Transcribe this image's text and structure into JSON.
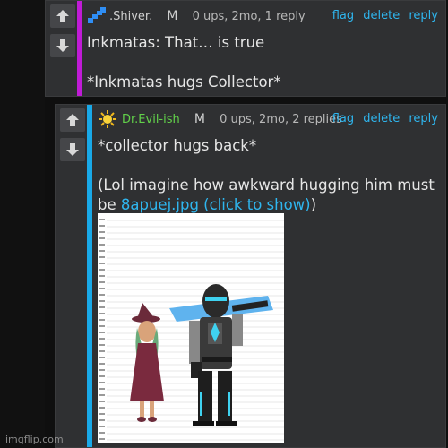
{
  "comments": [
    {
      "username": ".Shiver.",
      "mod_badge": "M",
      "stats": "0 ups, 2mo, 1 reply",
      "actions": [
        "flag",
        "delete",
        "reply"
      ],
      "line1": "Inkmatas: That… is true",
      "line2": "*Inkmatas hugs Collector*",
      "bar_color": "#c01bd6",
      "avatar_icon": "blue-pixel-icon"
    },
    {
      "username": "Dr.Evil-ish",
      "mod_badge": "M",
      "stats": "0 ups, 2mo, 2 replies",
      "actions": [
        "flag",
        "delete",
        "reply"
      ],
      "line1": "*collector hugs back*",
      "line2_prefix": "(Lol imagine how awkward hugging him must",
      "line3_prefix": "be ",
      "image_link": "8apuej.jpg (click to show)",
      "line3_suffix": ")",
      "bar_color": "#19a9e8",
      "avatar_icon": "sun-icon"
    }
  ],
  "watermark": "imgflip.com"
}
